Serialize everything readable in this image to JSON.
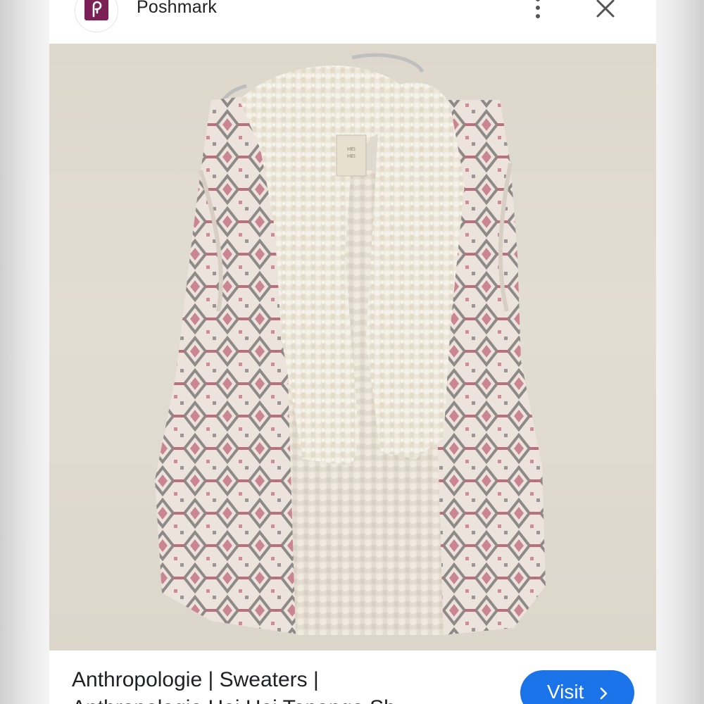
{
  "header": {
    "site_name": "Poshmark",
    "logo_icon": "poshmark-logo-icon",
    "more_icon": "more-vert-icon",
    "close_icon": "close-icon"
  },
  "image": {
    "subject": "vest-photo",
    "tag_text": "HEI HEI"
  },
  "result": {
    "title_line1": "Anthropologie | Sweaters |",
    "title_line2": "Anthropologie Hei Hei Topanga Sh"
  },
  "visit_button": {
    "label": "Visit",
    "icon": "chevron-right-icon",
    "color": "#1a73e8"
  }
}
